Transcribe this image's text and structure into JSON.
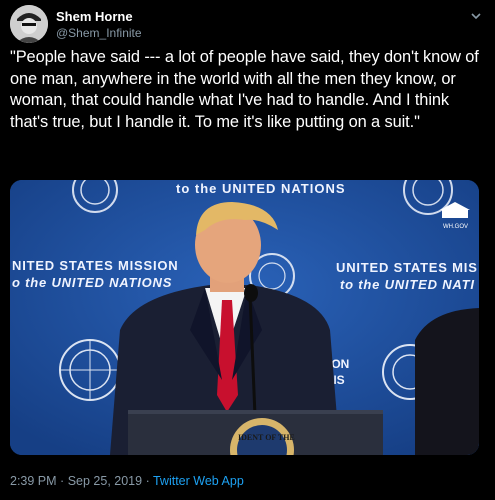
{
  "tweet": {
    "author": {
      "display_name": "Shem Horne",
      "handle": "@Shem_Infinite",
      "avatar_icon": "avatar-photo"
    },
    "text": "\"People have said --- a lot of people have said, they don't know of one man, anywhere in the world with all the men they know, or woman, that could handle what I've had to handle. And I think that's true, but I handle it. To me it's like putting on a suit.\"",
    "media": {
      "backdrop_top": "to the UNITED NATIONS",
      "backdrop_left_1": "NITED STATES MISSION",
      "backdrop_left_2": "o the UNITED NATIONS",
      "backdrop_right_1": "UNITED STATES MIS",
      "backdrop_right_2": "to the UNITED NATI",
      "backdrop_mid_1": "ION",
      "backdrop_mid_2": "NS",
      "wh_gov": "WH.GOV",
      "podium_seal": "IDENT OF THE",
      "colors": {
        "backdrop": "#1e4fa0",
        "suit": "#1a1f33",
        "tie": "#c8102e"
      }
    },
    "time": "2:39 PM",
    "separator": "·",
    "date": "Sep 25, 2019",
    "source": "Twitter Web App",
    "menu_icon": "chevron-down-icon"
  }
}
